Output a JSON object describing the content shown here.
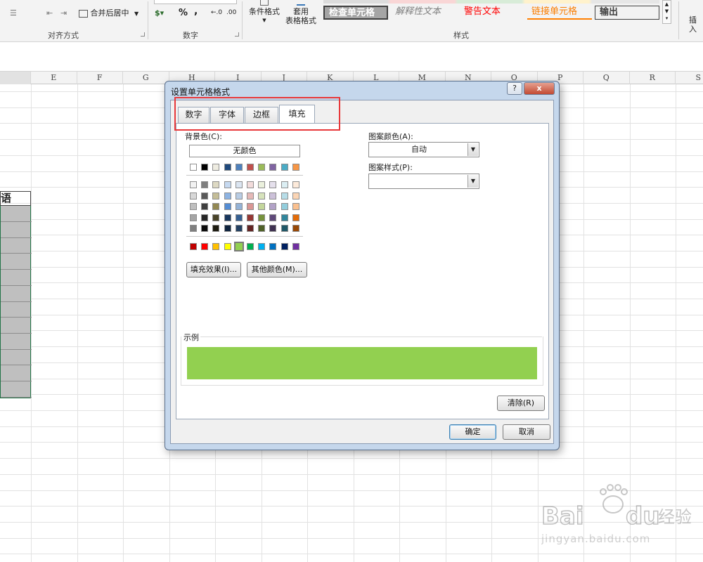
{
  "ribbon": {
    "merge_center": "合并后居中",
    "percent": "%",
    "comma": ",",
    "dec_increase": "←.0\n.00",
    "dec_decrease": ".00\n→.0",
    "conditional_format": "条件格式",
    "table_format_1": "套用",
    "table_format_2": "表格格式",
    "group_alignment": "对齐方式",
    "group_number": "数字",
    "group_styles": "样式",
    "insert": "插入",
    "styles": [
      {
        "label": "检查单元格",
        "color": "#ffffff",
        "bg": "#a5a5a5"
      },
      {
        "label": "解释性文本",
        "color": "#7f7f7f",
        "bg": "#ffffff"
      },
      {
        "label": "警告文本",
        "color": "#ff0000",
        "bg": "#ffffff"
      },
      {
        "label": "链接单元格",
        "color": "#fa7d00",
        "bg": "#ffffff"
      },
      {
        "label": "输出",
        "color": "#3f3f3f",
        "bg": "#f2f2f2"
      }
    ]
  },
  "sheet": {
    "columns": [
      "E",
      "F",
      "G",
      "H",
      "I",
      "J",
      "K",
      "L",
      "M",
      "N",
      "O",
      "P",
      "Q",
      "R",
      "S"
    ],
    "header_cell": "语"
  },
  "dialog": {
    "title": "设置单元格格式",
    "help": "?",
    "close": "x",
    "tabs": [
      "数字",
      "字体",
      "边框",
      "填充"
    ],
    "active_tab": "填充",
    "background_color_label": "背景色(C):",
    "no_color": "无颜色",
    "pattern_color_label": "图案颜色(A):",
    "pattern_color_value": "自动",
    "pattern_style_label": "图案样式(P):",
    "pattern_style_value": "",
    "fill_effects_button": "填充效果(I)...",
    "more_colors_button": "其他颜色(M)...",
    "sample_label": "示例",
    "clear_button": "清除(R)",
    "ok_button": "确定",
    "cancel_button": "取消",
    "sample_color": "#92d050",
    "theme_colors": [
      "#ffffff",
      "#000000",
      "#eeece1",
      "#1f497d",
      "#4f81bd",
      "#c0504d",
      "#9bbb59",
      "#8064a2",
      "#4bacc6",
      "#f79646"
    ],
    "tint_rows": [
      [
        "#f2f2f2",
        "#7f7f7f",
        "#ddd9c3",
        "#c6d9f0",
        "#dbe5f1",
        "#f2dcdb",
        "#ebf1dd",
        "#e5e0ec",
        "#dbeef3",
        "#fdeada"
      ],
      [
        "#d8d8d8",
        "#595959",
        "#c4bd97",
        "#8db3e2",
        "#b8cce4",
        "#e5b9b7",
        "#d7e3bc",
        "#ccc1d9",
        "#b7dde8",
        "#fbd5b5"
      ],
      [
        "#bfbfbf",
        "#3f3f3f",
        "#938953",
        "#548dd4",
        "#95b3d7",
        "#d99694",
        "#c3d69b",
        "#b2a2c7",
        "#92cddc",
        "#fac08f"
      ],
      [
        "#a5a5a5",
        "#262626",
        "#494429",
        "#17365d",
        "#366092",
        "#953734",
        "#76923c",
        "#5f497a",
        "#31859b",
        "#e36c09"
      ],
      [
        "#7f7f7f",
        "#0c0c0c",
        "#1d1b10",
        "#0f243e",
        "#244061",
        "#632423",
        "#4f6128",
        "#3f3151",
        "#205867",
        "#974806"
      ]
    ],
    "standard_colors": [
      "#c00000",
      "#ff0000",
      "#ffc000",
      "#ffff00",
      "#92d050",
      "#00b050",
      "#00b0f0",
      "#0070c0",
      "#002060",
      "#7030a0"
    ],
    "selected_standard_index": 4
  },
  "watermark": {
    "text": "Bai du 经验",
    "sub": "jingyan.baidu.com"
  }
}
